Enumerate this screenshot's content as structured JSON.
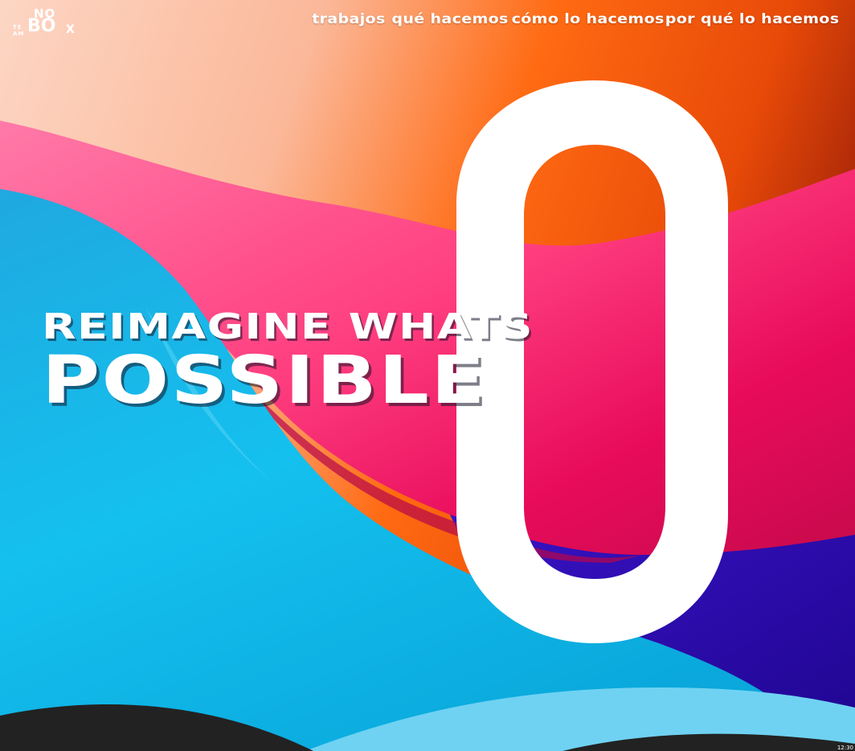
{
  "logo": {
    "te": "TE",
    "am": "AM",
    "no": "NO",
    "box": "BO",
    "x": "X"
  },
  "nav": {
    "items": [
      {
        "label": "trabajos"
      },
      {
        "label": "qué hacemos"
      },
      {
        "label": "cómo lo hacemos"
      },
      {
        "label": "por qué lo hacemos"
      }
    ]
  },
  "hero": {
    "line1": "REIMAGINE WHATS",
    "line2": "POSSIBLE"
  },
  "status": {
    "time": "12:30"
  },
  "colors": {
    "cyan": "#1bb8e6",
    "pink": "#ff2e74",
    "orange": "#ff5a0a",
    "purple": "#2a0aa8",
    "peach": "#fcd3bd",
    "dark": "#222222"
  }
}
